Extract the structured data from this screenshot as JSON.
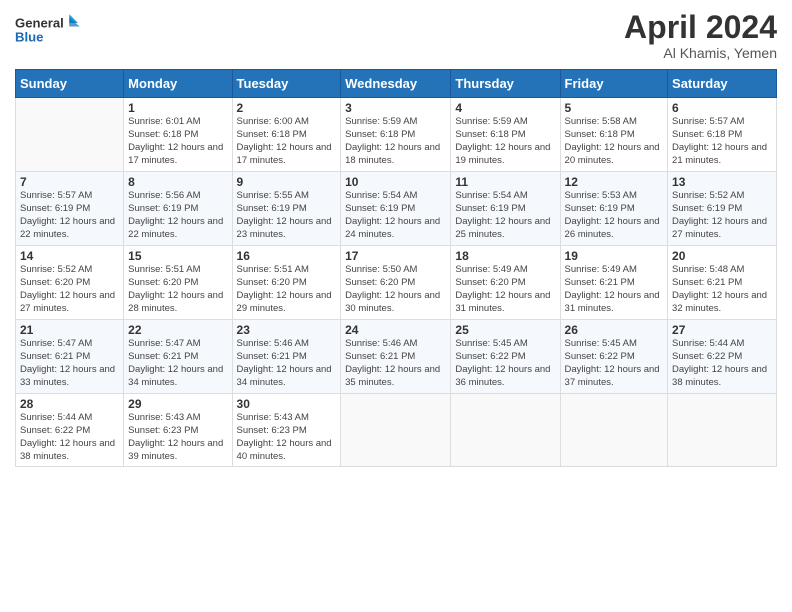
{
  "header": {
    "logo_line1": "General",
    "logo_line2": "Blue",
    "month": "April 2024",
    "location": "Al Khamis, Yemen"
  },
  "days_of_week": [
    "Sunday",
    "Monday",
    "Tuesday",
    "Wednesday",
    "Thursday",
    "Friday",
    "Saturday"
  ],
  "weeks": [
    [
      {
        "day": "",
        "sunrise": "",
        "sunset": "",
        "daylight": ""
      },
      {
        "day": "1",
        "sunrise": "Sunrise: 6:01 AM",
        "sunset": "Sunset: 6:18 PM",
        "daylight": "Daylight: 12 hours and 17 minutes."
      },
      {
        "day": "2",
        "sunrise": "Sunrise: 6:00 AM",
        "sunset": "Sunset: 6:18 PM",
        "daylight": "Daylight: 12 hours and 17 minutes."
      },
      {
        "day": "3",
        "sunrise": "Sunrise: 5:59 AM",
        "sunset": "Sunset: 6:18 PM",
        "daylight": "Daylight: 12 hours and 18 minutes."
      },
      {
        "day": "4",
        "sunrise": "Sunrise: 5:59 AM",
        "sunset": "Sunset: 6:18 PM",
        "daylight": "Daylight: 12 hours and 19 minutes."
      },
      {
        "day": "5",
        "sunrise": "Sunrise: 5:58 AM",
        "sunset": "Sunset: 6:18 PM",
        "daylight": "Daylight: 12 hours and 20 minutes."
      },
      {
        "day": "6",
        "sunrise": "Sunrise: 5:57 AM",
        "sunset": "Sunset: 6:18 PM",
        "daylight": "Daylight: 12 hours and 21 minutes."
      }
    ],
    [
      {
        "day": "7",
        "sunrise": "Sunrise: 5:57 AM",
        "sunset": "Sunset: 6:19 PM",
        "daylight": "Daylight: 12 hours and 22 minutes."
      },
      {
        "day": "8",
        "sunrise": "Sunrise: 5:56 AM",
        "sunset": "Sunset: 6:19 PM",
        "daylight": "Daylight: 12 hours and 22 minutes."
      },
      {
        "day": "9",
        "sunrise": "Sunrise: 5:55 AM",
        "sunset": "Sunset: 6:19 PM",
        "daylight": "Daylight: 12 hours and 23 minutes."
      },
      {
        "day": "10",
        "sunrise": "Sunrise: 5:54 AM",
        "sunset": "Sunset: 6:19 PM",
        "daylight": "Daylight: 12 hours and 24 minutes."
      },
      {
        "day": "11",
        "sunrise": "Sunrise: 5:54 AM",
        "sunset": "Sunset: 6:19 PM",
        "daylight": "Daylight: 12 hours and 25 minutes."
      },
      {
        "day": "12",
        "sunrise": "Sunrise: 5:53 AM",
        "sunset": "Sunset: 6:19 PM",
        "daylight": "Daylight: 12 hours and 26 minutes."
      },
      {
        "day": "13",
        "sunrise": "Sunrise: 5:52 AM",
        "sunset": "Sunset: 6:19 PM",
        "daylight": "Daylight: 12 hours and 27 minutes."
      }
    ],
    [
      {
        "day": "14",
        "sunrise": "Sunrise: 5:52 AM",
        "sunset": "Sunset: 6:20 PM",
        "daylight": "Daylight: 12 hours and 27 minutes."
      },
      {
        "day": "15",
        "sunrise": "Sunrise: 5:51 AM",
        "sunset": "Sunset: 6:20 PM",
        "daylight": "Daylight: 12 hours and 28 minutes."
      },
      {
        "day": "16",
        "sunrise": "Sunrise: 5:51 AM",
        "sunset": "Sunset: 6:20 PM",
        "daylight": "Daylight: 12 hours and 29 minutes."
      },
      {
        "day": "17",
        "sunrise": "Sunrise: 5:50 AM",
        "sunset": "Sunset: 6:20 PM",
        "daylight": "Daylight: 12 hours and 30 minutes."
      },
      {
        "day": "18",
        "sunrise": "Sunrise: 5:49 AM",
        "sunset": "Sunset: 6:20 PM",
        "daylight": "Daylight: 12 hours and 31 minutes."
      },
      {
        "day": "19",
        "sunrise": "Sunrise: 5:49 AM",
        "sunset": "Sunset: 6:21 PM",
        "daylight": "Daylight: 12 hours and 31 minutes."
      },
      {
        "day": "20",
        "sunrise": "Sunrise: 5:48 AM",
        "sunset": "Sunset: 6:21 PM",
        "daylight": "Daylight: 12 hours and 32 minutes."
      }
    ],
    [
      {
        "day": "21",
        "sunrise": "Sunrise: 5:47 AM",
        "sunset": "Sunset: 6:21 PM",
        "daylight": "Daylight: 12 hours and 33 minutes."
      },
      {
        "day": "22",
        "sunrise": "Sunrise: 5:47 AM",
        "sunset": "Sunset: 6:21 PM",
        "daylight": "Daylight: 12 hours and 34 minutes."
      },
      {
        "day": "23",
        "sunrise": "Sunrise: 5:46 AM",
        "sunset": "Sunset: 6:21 PM",
        "daylight": "Daylight: 12 hours and 34 minutes."
      },
      {
        "day": "24",
        "sunrise": "Sunrise: 5:46 AM",
        "sunset": "Sunset: 6:21 PM",
        "daylight": "Daylight: 12 hours and 35 minutes."
      },
      {
        "day": "25",
        "sunrise": "Sunrise: 5:45 AM",
        "sunset": "Sunset: 6:22 PM",
        "daylight": "Daylight: 12 hours and 36 minutes."
      },
      {
        "day": "26",
        "sunrise": "Sunrise: 5:45 AM",
        "sunset": "Sunset: 6:22 PM",
        "daylight": "Daylight: 12 hours and 37 minutes."
      },
      {
        "day": "27",
        "sunrise": "Sunrise: 5:44 AM",
        "sunset": "Sunset: 6:22 PM",
        "daylight": "Daylight: 12 hours and 38 minutes."
      }
    ],
    [
      {
        "day": "28",
        "sunrise": "Sunrise: 5:44 AM",
        "sunset": "Sunset: 6:22 PM",
        "daylight": "Daylight: 12 hours and 38 minutes."
      },
      {
        "day": "29",
        "sunrise": "Sunrise: 5:43 AM",
        "sunset": "Sunset: 6:23 PM",
        "daylight": "Daylight: 12 hours and 39 minutes."
      },
      {
        "day": "30",
        "sunrise": "Sunrise: 5:43 AM",
        "sunset": "Sunset: 6:23 PM",
        "daylight": "Daylight: 12 hours and 40 minutes."
      },
      {
        "day": "",
        "sunrise": "",
        "sunset": "",
        "daylight": ""
      },
      {
        "day": "",
        "sunrise": "",
        "sunset": "",
        "daylight": ""
      },
      {
        "day": "",
        "sunrise": "",
        "sunset": "",
        "daylight": ""
      },
      {
        "day": "",
        "sunrise": "",
        "sunset": "",
        "daylight": ""
      }
    ]
  ]
}
